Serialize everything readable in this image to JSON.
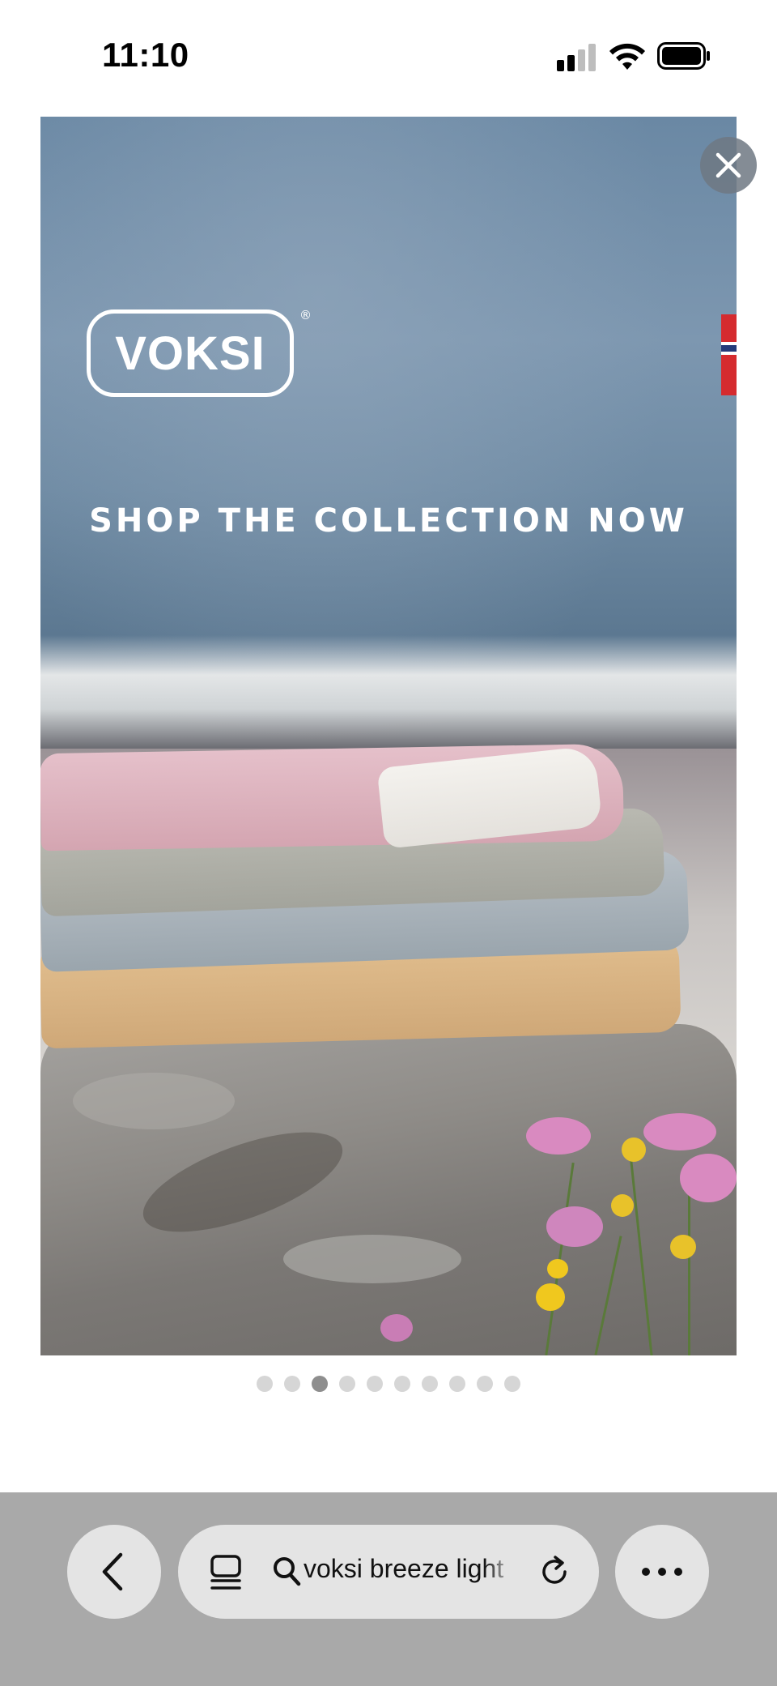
{
  "status_bar": {
    "time": "11:10",
    "signal_icon": "cellular-signal-icon",
    "wifi_icon": "wifi-icon",
    "battery_icon": "battery-icon"
  },
  "ad": {
    "brand_logo": "VOKSI",
    "registered_mark": "®",
    "headline": "SHOP THE COLLECTION NOW",
    "close_icon": "close-icon"
  },
  "carousel": {
    "total_pages": 10,
    "active_index": 2
  },
  "browser_toolbar": {
    "back_icon": "chevron-left-icon",
    "tabs_icon": "tab-overview-icon",
    "search_icon": "search-icon",
    "address_text": "voksi breeze light",
    "reload_icon": "reload-icon",
    "more_icon": "ellipsis-icon"
  },
  "colors": {
    "toolbar_bg": "#a9a9a9",
    "button_bg": "#e4e4e4",
    "dot_active": "#8e8e8e",
    "dot_inactive": "#d6d6d6"
  }
}
